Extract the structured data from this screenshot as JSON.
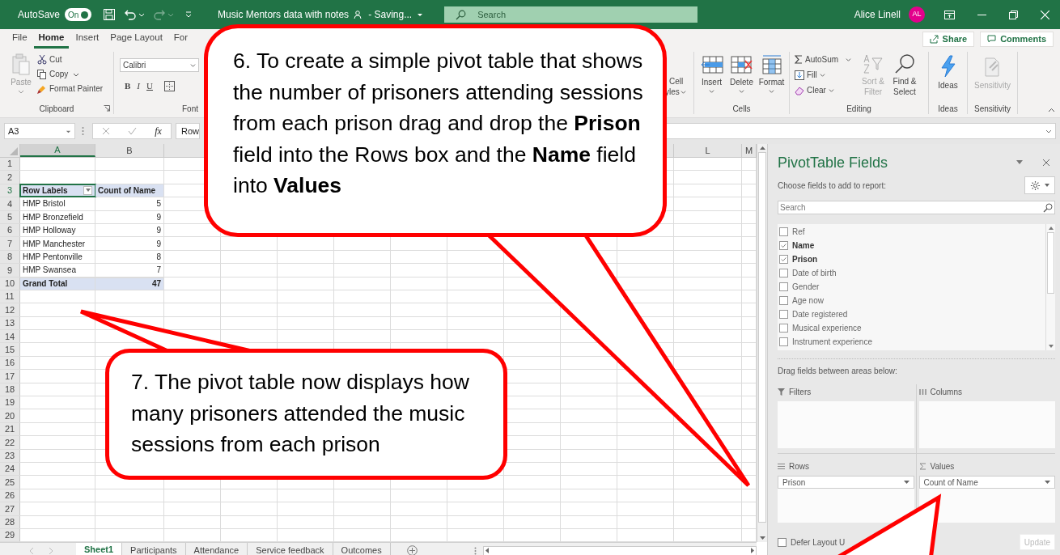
{
  "title_bar": {
    "autosave_label": "AutoSave",
    "autosave": {
      "label": "On",
      "on": true
    },
    "file_name": "Music Mentors data with notes",
    "save_status": "- Saving...",
    "search_placeholder": "Search",
    "user_name": "Alice Linell",
    "user_initials": "AL"
  },
  "ribbon_tabs": [
    {
      "label": "File",
      "selected": false
    },
    {
      "label": "Home",
      "selected": true
    },
    {
      "label": "Insert",
      "selected": false
    },
    {
      "label": "Page Layout",
      "selected": false
    },
    {
      "label": "For",
      "selected": false
    }
  ],
  "share_button": "Share",
  "comments_button": "Comments",
  "clipboard": {
    "paste": "Paste",
    "cut": "Cut",
    "copy": "Copy",
    "format_painter": "Format Painter",
    "group_label": "Clipboard"
  },
  "font": {
    "font_name": "Calibri",
    "style_buttons": [
      "B",
      "I",
      "U"
    ],
    "group_label": "Font"
  },
  "styles": {
    "label_top": "Cell",
    "label_bottom": "yles"
  },
  "cells": {
    "buttons": [
      "Insert",
      "Delete",
      "Format"
    ],
    "group_label": "Cells"
  },
  "editing": {
    "autosum": "AutoSum",
    "fill": "Fill",
    "clear": "Clear",
    "sort_filter": {
      "label": "Sort & Filter",
      "disabled": true
    },
    "find_select": {
      "label": "Find & Select",
      "disabled": false
    },
    "group_label": "Editing"
  },
  "ideas": {
    "label": "Ideas",
    "group_label": "Ideas"
  },
  "sensitivity": {
    "label": "Sensitivity",
    "disabled": true,
    "group_label": "Sensitivity"
  },
  "formula_bar": {
    "name_box": "A3",
    "function_label": "fx",
    "content": "Row"
  },
  "sheet": {
    "column_headings": [
      "A",
      "B",
      "L",
      "M"
    ],
    "row_numbers": [
      "1",
      "2",
      "3",
      "4",
      "5",
      "6",
      "7",
      "8",
      "9",
      "10",
      "11",
      "12",
      "13",
      "14",
      "15",
      "16",
      "17",
      "18",
      "19",
      "20",
      "21",
      "22",
      "23",
      "24",
      "25",
      "26",
      "27",
      "28",
      "29"
    ],
    "pivot": {
      "header": [
        "Row Labels",
        "Count of Name"
      ],
      "rows": [
        {
          "label": "HMP Bristol",
          "count": "5"
        },
        {
          "label": "HMP Bronzefield",
          "count": "9"
        },
        {
          "label": "HMP Holloway",
          "count": "9"
        },
        {
          "label": "HMP Manchester",
          "count": "9"
        },
        {
          "label": "HMP Pentonville",
          "count": "8"
        },
        {
          "label": "HMP Swansea",
          "count": "7"
        }
      ],
      "total": {
        "label": "Grand Total",
        "count": "47"
      }
    }
  },
  "sheet_tabs": [
    {
      "label": "Sheet1",
      "selected": true
    },
    {
      "label": "Participants",
      "selected": false
    },
    {
      "label": "Attendance",
      "selected": false
    },
    {
      "label": "Service feedback",
      "selected": false
    },
    {
      "label": "Outcomes",
      "selected": false
    }
  ],
  "pivot_panel": {
    "title": "PivotTable Fields",
    "subtitle": "Choose fields to add to report:",
    "search_placeholder": "Search",
    "fields": [
      {
        "label": "Ref",
        "checked": false
      },
      {
        "label": "Name",
        "checked": true
      },
      {
        "label": "Prison",
        "checked": true
      },
      {
        "label": "Date of birth",
        "checked": false
      },
      {
        "label": "Gender",
        "checked": false
      },
      {
        "label": "Age now",
        "checked": false
      },
      {
        "label": "Date registered",
        "checked": false
      },
      {
        "label": "Musical experience",
        "checked": false
      },
      {
        "label": "Instrument experience",
        "checked": false
      }
    ],
    "areas_hint": "Drag fields between areas below:",
    "areas": [
      {
        "kind": "filters",
        "label": "Filters"
      },
      {
        "kind": "columns",
        "label": "Columns"
      },
      {
        "kind": "rows",
        "label": "Rows",
        "items": [
          "Prison"
        ]
      },
      {
        "kind": "values",
        "label": "Values",
        "items": [
          "Count of Name"
        ]
      }
    ],
    "defer": {
      "label": "Defer Layout U",
      "checked": false
    },
    "update_button": {
      "label": "Update",
      "disabled": true
    }
  },
  "callouts": [
    {
      "text": "6. To create a simple pivot table that shows the number of prisoners attending sessions from each prison drag and drop the **Prison** field into the Rows box and the **Name** field into **Values**"
    },
    {
      "text": "7. The pivot table now displays how many prisoners attended the music sessions from each prison"
    }
  ]
}
